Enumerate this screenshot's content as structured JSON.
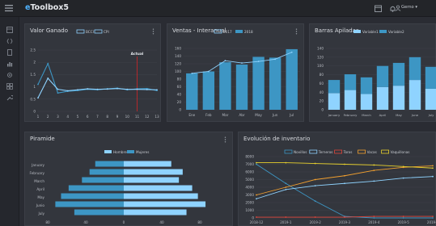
{
  "app": {
    "brand_prefix": "e",
    "brand_suffix": "Toolbox5",
    "user_name": "Gerno"
  },
  "colors": {
    "accent": "#4fb3ff",
    "series_blue": "#3d96c4",
    "series_light": "#8fd3ff",
    "series_white": "#e8ecf1",
    "marker_red": "#c2282a",
    "orange": "#f2a02f",
    "yellow": "#e8d12d",
    "red": "#e2453a"
  },
  "panels": {
    "valor": {
      "title": "Valor Ganado"
    },
    "ventas": {
      "title": "Ventas - Interanual"
    },
    "barras": {
      "title": "Barras Apiladas"
    },
    "piramide": {
      "title": "Piramide"
    },
    "evolucion": {
      "title": "Evolución de inventario"
    }
  },
  "chart_data": [
    {
      "type": "line",
      "title": "Valor Ganado",
      "x": [
        1,
        2,
        3,
        4,
        5,
        6,
        7,
        8,
        9,
        10,
        11,
        12,
        13
      ],
      "ylim": [
        0,
        2.5
      ],
      "yticks": [
        "0",
        "0.5",
        "1",
        "1.5",
        "2",
        "2.5"
      ],
      "series": [
        {
          "name": "BCCI",
          "values": [
            1.1,
            1.95,
            0.75,
            0.82,
            0.85,
            0.9,
            0.88,
            0.92,
            0.95,
            0.88,
            0.92,
            0.93,
            0.85
          ]
        },
        {
          "name": "CPI",
          "values": [
            0.55,
            1.35,
            0.9,
            0.84,
            0.88,
            0.92,
            0.9,
            0.91,
            0.93,
            0.9,
            0.9,
            0.89,
            0.88
          ]
        }
      ],
      "annotation": {
        "label": "Actual",
        "x": 11
      }
    },
    {
      "type": "bar",
      "title": "Ventas - Interanual",
      "categories": [
        "Ene",
        "Feb",
        "Mar",
        "Abr",
        "May",
        "Jun",
        "Jul"
      ],
      "ylim": [
        0,
        160
      ],
      "yticks": [
        "0",
        "20",
        "40",
        "60",
        "80",
        "100",
        "120",
        "140",
        "160"
      ],
      "series": [
        {
          "name": "2017",
          "values": [
            95,
            100,
            128,
            122,
            126,
            132,
            150
          ]
        },
        {
          "name": "2018",
          "values": [
            95,
            100,
            124,
            118,
            138,
            136,
            158
          ]
        }
      ]
    },
    {
      "type": "bar",
      "title": "Barras Apiladas",
      "categories": [
        "January",
        "February",
        "March",
        "April",
        "May",
        "June",
        "July"
      ],
      "ylim": [
        0,
        140
      ],
      "yticks": [
        "0",
        "20",
        "40",
        "60",
        "80",
        "100",
        "120",
        "140"
      ],
      "series": [
        {
          "name": "Variable1",
          "values": [
            38,
            45,
            36,
            52,
            55,
            68,
            48
          ]
        },
        {
          "name": "Variable2",
          "values": [
            30,
            36,
            38,
            48,
            52,
            52,
            50
          ]
        }
      ]
    },
    {
      "type": "bar",
      "title": "Piramide",
      "categories": [
        "January",
        "February",
        "March",
        "April",
        "May",
        "Junio",
        "July"
      ],
      "xticks": [
        "80",
        "40",
        "0",
        "40",
        "80"
      ],
      "series": [
        {
          "name": "Hombres",
          "values": [
            -30,
            -36,
            -44,
            -58,
            -66,
            -72,
            -52
          ]
        },
        {
          "name": "Mujeres",
          "values": [
            50,
            62,
            58,
            72,
            78,
            86,
            66
          ]
        }
      ]
    },
    {
      "type": "line",
      "title": "Evolución de inventario",
      "categories": [
        "2018-12",
        "2019-1",
        "2019-2",
        "2019-3",
        "2019-4",
        "2019-5",
        "2019-6"
      ],
      "ylim": [
        0,
        8000
      ],
      "yticks": [
        "0",
        "1000",
        "2000",
        "3000",
        "4000",
        "5000",
        "6000",
        "7000",
        "8000"
      ],
      "series": [
        {
          "name": "Novillos",
          "color": "#3d96c4",
          "values": [
            7000,
            4500,
            2200,
            200,
            0,
            0,
            0
          ]
        },
        {
          "name": "Terneros",
          "color": "#8fd3ff",
          "values": [
            2500,
            3700,
            4200,
            4500,
            4800,
            5200,
            5400
          ]
        },
        {
          "name": "Toros",
          "color": "#e2453a",
          "values": [
            100,
            100,
            100,
            100,
            200,
            200,
            200
          ]
        },
        {
          "name": "Vacas",
          "color": "#f2a02f",
          "values": [
            3000,
            4000,
            5000,
            5500,
            6200,
            6600,
            6800
          ]
        },
        {
          "name": "Vaquillonas",
          "color": "#e8d12d",
          "values": [
            7200,
            7200,
            7100,
            7000,
            6900,
            6700,
            6500
          ]
        }
      ]
    }
  ]
}
